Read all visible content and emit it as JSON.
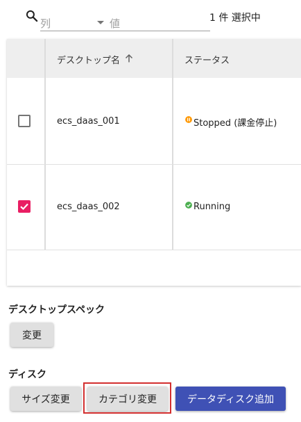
{
  "filter": {
    "column_placeholder": "列",
    "value_placeholder": "値",
    "selected_count": "1 件 選択中",
    "icon": "search-icon"
  },
  "table": {
    "headers": {
      "desktop_name": "デスクトップ名",
      "status": "ステータス"
    },
    "sort": {
      "column": "desktop_name",
      "direction": "ascending",
      "icon": "arrow-up-icon"
    },
    "rows": [
      {
        "selected": false,
        "desktop_name": "ecs_daas_001",
        "status": "Stopped (課金停止)",
        "status_icon": "pause-icon",
        "status_color": "#ff9800"
      },
      {
        "selected": true,
        "desktop_name": "ecs_daas_002",
        "status": "Running",
        "status_icon": "check-icon",
        "status_color": "#4caf50"
      }
    ]
  },
  "spec_section": {
    "title": "デスクトップスペック",
    "change_button": "変更"
  },
  "disk_section": {
    "title": "ディスク",
    "size_button": "サイズ変更",
    "category_button": "カテゴリ変更",
    "add_data_disk_button": "データディスク追加"
  },
  "colors": {
    "checkbox_checked": "#e91e63",
    "primary": "#3f51b5",
    "highlight": "#d32f2f"
  }
}
